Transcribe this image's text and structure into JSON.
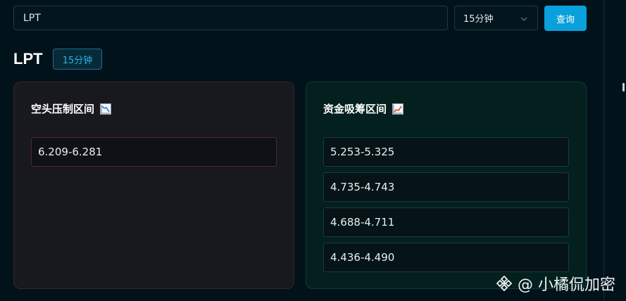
{
  "search": {
    "value": "LPT"
  },
  "interval_select": {
    "selected": "15分钟"
  },
  "query_button": {
    "label": "查询"
  },
  "symbol": {
    "title": "LPT",
    "interval_badge": "15分钟"
  },
  "short_panel": {
    "title": "空头压制区间",
    "icon": "chart-decreasing-icon",
    "ranges": [
      "6.209-6.281"
    ]
  },
  "long_panel": {
    "title": "资金吸筹区间",
    "icon": "chart-increasing-icon",
    "ranges": [
      "5.253-5.325",
      "4.735-4.743",
      "4.688-4.711",
      "4.436-4.490"
    ]
  },
  "watermark": {
    "text": "@ 小橘侃加密",
    "icon": "binance-logo-icon"
  },
  "colors": {
    "background": "#02121a",
    "accent": "#0aa0dc",
    "short_border": "#4a2a2c",
    "long_background": "#03201e"
  }
}
